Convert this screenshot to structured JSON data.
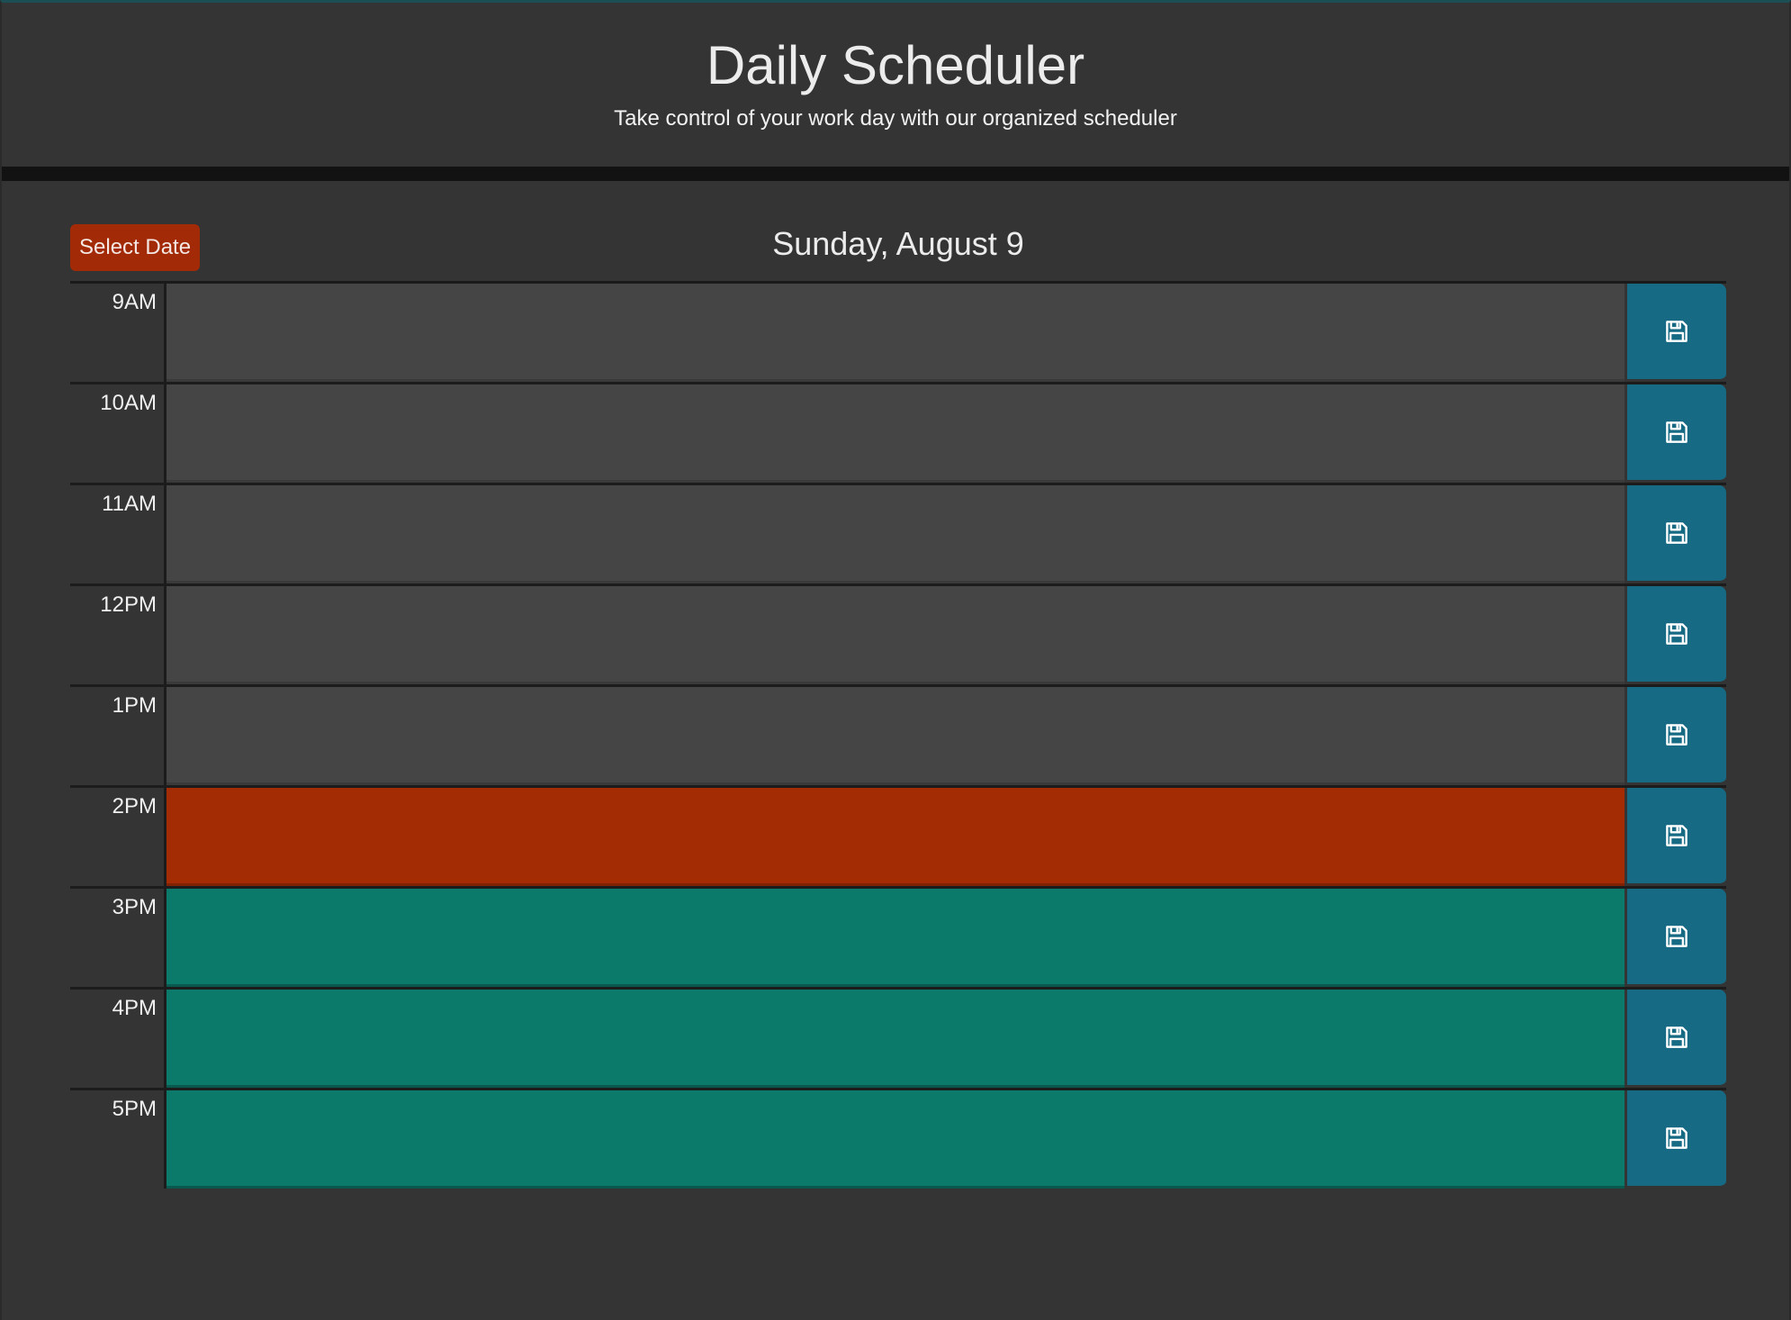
{
  "header": {
    "title": "Daily Scheduler",
    "subtitle": "Take control of your work day with our organized scheduler"
  },
  "toolbar": {
    "select_date_label": "Select Date",
    "current_date": "Sunday, August 9"
  },
  "colors": {
    "past": "#454545",
    "present": "#a32c05",
    "future": "#0b7a6a",
    "save_button": "#176a84",
    "select_date_button": "#a22a06"
  },
  "rows": [
    {
      "hour": "9AM",
      "status": "past",
      "text": "",
      "save_icon": "save-icon"
    },
    {
      "hour": "10AM",
      "status": "past",
      "text": "",
      "save_icon": "save-icon"
    },
    {
      "hour": "11AM",
      "status": "past",
      "text": "",
      "save_icon": "save-icon"
    },
    {
      "hour": "12PM",
      "status": "past",
      "text": "",
      "save_icon": "save-icon"
    },
    {
      "hour": "1PM",
      "status": "past",
      "text": "",
      "save_icon": "save-icon"
    },
    {
      "hour": "2PM",
      "status": "present",
      "text": "",
      "save_icon": "save-icon"
    },
    {
      "hour": "3PM",
      "status": "future",
      "text": "",
      "save_icon": "save-icon"
    },
    {
      "hour": "4PM",
      "status": "future",
      "text": "",
      "save_icon": "save-icon"
    },
    {
      "hour": "5PM",
      "status": "future",
      "text": "",
      "save_icon": "save-icon"
    }
  ]
}
